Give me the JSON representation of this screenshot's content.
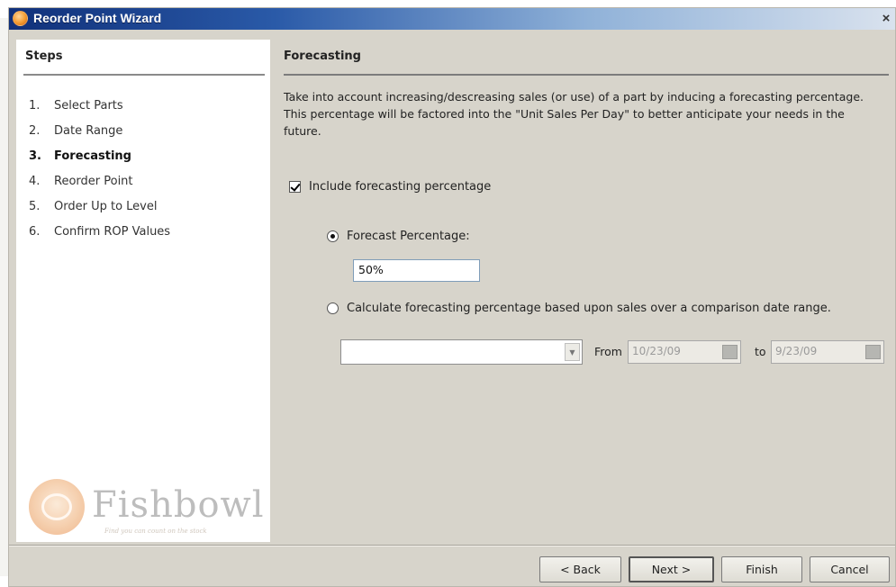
{
  "window": {
    "title": "Reorder Point Wizard",
    "close_glyph": "×"
  },
  "steps": {
    "header": "Steps",
    "items": [
      {
        "num": "1.",
        "label": "Select Parts",
        "active": false
      },
      {
        "num": "2.",
        "label": "Date Range",
        "active": false
      },
      {
        "num": "3.",
        "label": "Forecasting",
        "active": true
      },
      {
        "num": "4.",
        "label": "Reorder Point",
        "active": false
      },
      {
        "num": "5.",
        "label": "Order Up to Level",
        "active": false
      },
      {
        "num": "6.",
        "label": "Confirm ROP Values",
        "active": false
      }
    ]
  },
  "logo": {
    "name": "Fishbowl",
    "tagline": "Find you can count on the stock"
  },
  "content": {
    "title": "Forecasting",
    "description": "Take into account increasing/descreasing sales (or use) of a part by inducing a forecasting percentage.  This percentage will be factored into the \"Unit Sales Per Day\" to better anticipate your needs in the future.",
    "include_label": "Include forecasting percentage",
    "include_checked": true,
    "forecast_pct_label": "Forecast Percentage:",
    "forecast_pct_selected": true,
    "forecast_pct_value": "50%",
    "calc_label": "Calculate forecasting percentage based upon sales over a comparison date range.",
    "calc_selected": false,
    "range_combo_value": "",
    "from_label": "From",
    "from_value": "10/23/09",
    "to_label": "to",
    "to_value": "9/23/09"
  },
  "buttons": {
    "back": "< Back",
    "next": "Next >",
    "finish": "Finish",
    "cancel": "Cancel"
  },
  "colors": {
    "titlebar_start": "#10307a",
    "titlebar_end": "#d9e2ee",
    "window_bg": "#d7d4cb",
    "logo_orange": "#f39a2e"
  },
  "icons": {
    "title_icon": "fishbowl-logo-icon",
    "close": "close-icon",
    "combo_arrow": "chevron-down-icon",
    "calendar": "calendar-icon"
  }
}
